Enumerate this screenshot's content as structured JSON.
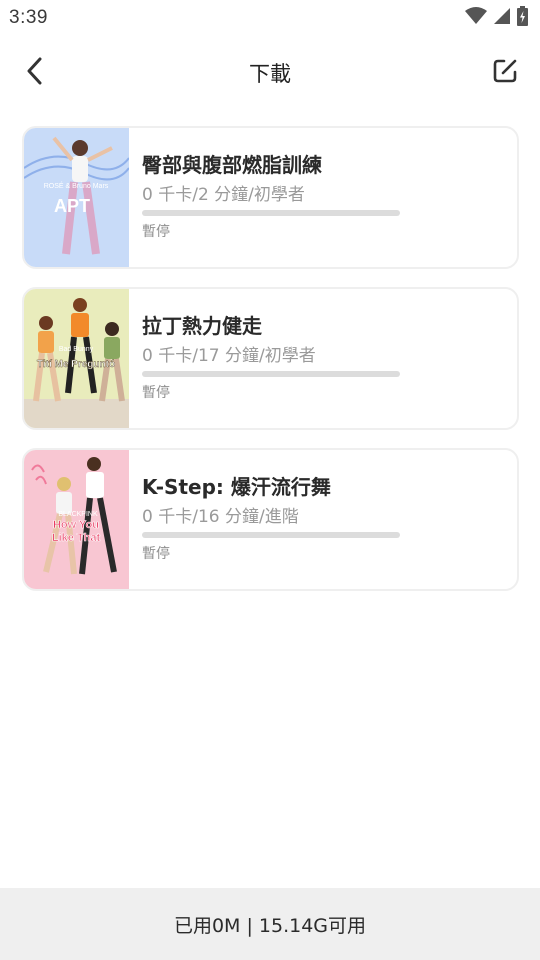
{
  "status_bar": {
    "time": "3:39"
  },
  "header": {
    "title": "下載",
    "back_icon": "chevron-left-icon",
    "edit_icon": "edit-square-icon"
  },
  "downloads": [
    {
      "title": "臀部與腹部燃脂訓練",
      "meta": "0 千卡/2 分鐘/初學者",
      "status": "暫停",
      "progress": 0,
      "thumb_caption": "ROSÉ & Bruno Mars",
      "thumb_title": "APT",
      "thumb_bg": "#bcd3f5"
    },
    {
      "title": "拉丁熱力健走",
      "meta": "0 千卡/17 分鐘/初學者",
      "status": "暫停",
      "progress": 0,
      "thumb_caption": "Bad Bunny",
      "thumb_title": "Tití Me Preguntó",
      "thumb_bg": "#e6e9b8"
    },
    {
      "title": "K-Step: 爆汗流行舞",
      "meta": "0 千卡/16 分鐘/進階",
      "status": "暫停",
      "progress": 0,
      "thumb_caption": "BLACKPINK",
      "thumb_title_line1": "How You",
      "thumb_title_line2": "Like That",
      "thumb_bg": "#f7c3cf"
    }
  ],
  "footer": {
    "storage": "已用0M | 15.14G可用"
  },
  "colors": {
    "accent": "#2b2b2b",
    "card_border": "#efefef",
    "footer_bg": "#efefef"
  }
}
